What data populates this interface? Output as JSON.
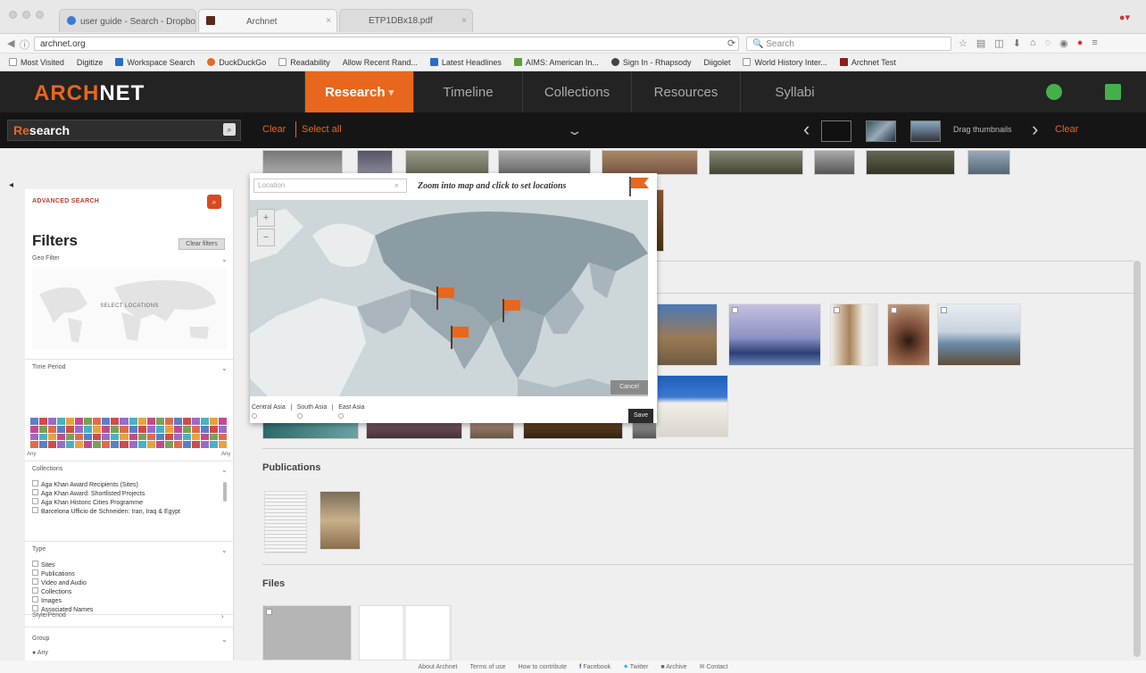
{
  "browser": {
    "tabs": [
      {
        "label": "user guide - Search - Dropbox"
      },
      {
        "label": "Archnet"
      },
      {
        "label": "ETP1DBx18.pdf"
      }
    ],
    "url": "archnet.org",
    "search_placeholder": "Search",
    "bookmarks": [
      "Most Visited",
      "Digitize",
      "Workspace Search",
      "DuckDuckGo",
      "Readability",
      "Allow Recent Rand...",
      "Latest Headlines",
      "AIMS: American In...",
      "Sign In - Rhapsody",
      "Diigolet",
      "World History Inter...",
      "Archnet Test"
    ]
  },
  "header": {
    "logo_part1": "ARCH",
    "logo_part2": "NET",
    "nav": [
      "Research",
      "Timeline",
      "Collections",
      "Resources",
      "Syllabi"
    ],
    "active_nav": "Research"
  },
  "searchbar": {
    "title_first": "Re",
    "title_rest": "search",
    "clear": "Clear",
    "select_all": "Select all",
    "drag_thumbnails": "Drag thumbnails",
    "clear_right": "Clear"
  },
  "sidebar": {
    "advanced_search": "ADVANCED SEARCH",
    "filters_title": "Filters",
    "clear_filters": "Clear filters",
    "geo_filter": "Geo Filter",
    "select_locations": "SELECT LOCATIONS",
    "time_period": "Time Period",
    "time_any_left": "Any",
    "time_any_right": "Any",
    "collections_label": "Collections",
    "collections": [
      "Aga Khan Award Recipients (Sites)",
      "Aga Khan Award: Shortlisted Projects",
      "Aga Khan Historic Cities Programme",
      "Barcelona Ufficio de Schneiden: Iran, Iraq & Egypt"
    ],
    "type_label": "Type",
    "types": [
      "Sites",
      "Publications",
      "Video and Audio",
      "Collections",
      "Images",
      "Associated Names"
    ],
    "style_period": "Style/Period",
    "group": "Group",
    "group_first": "Any"
  },
  "map_modal": {
    "location_placeholder": "Location",
    "instruction": "Zoom into map and click to set locations",
    "zoom_in": "+",
    "zoom_out": "−",
    "cancel": "Cancel",
    "save": "Save",
    "regions": [
      "Central Asia",
      "South Asia",
      "East Asia"
    ]
  },
  "results": {
    "publications_title": "Publications",
    "files_title": "Files"
  },
  "footer": {
    "links": [
      "About Archnet",
      "Terms of use",
      "How to contribute",
      "Facebook",
      "Twitter",
      "Archive",
      "Contact"
    ]
  },
  "colors": {
    "accent": "#e8671c",
    "header_bg": "#232323",
    "search_bg": "#151515",
    "green": "#43b04a"
  }
}
